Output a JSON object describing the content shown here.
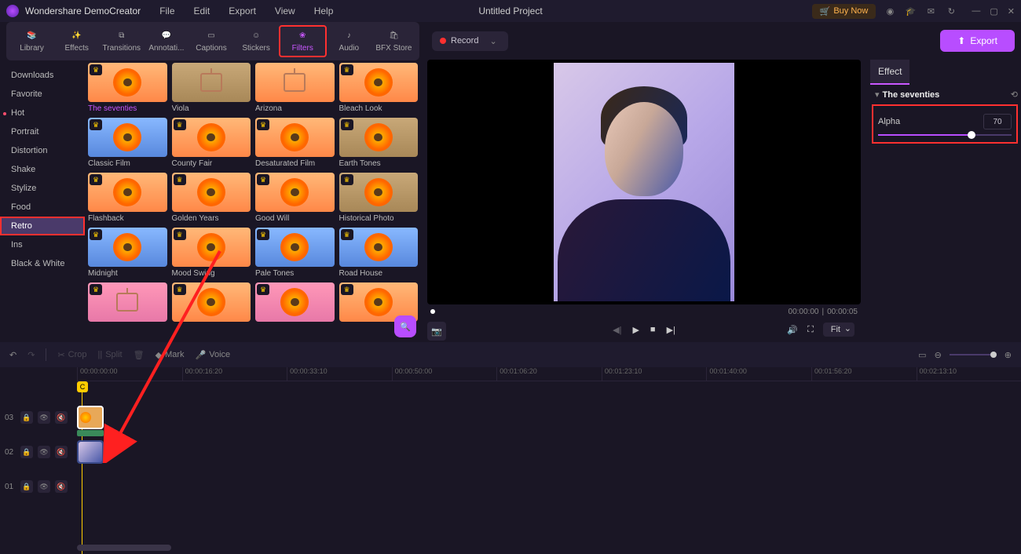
{
  "app": {
    "name": "Wondershare DemoCreator",
    "project": "Untitled Project"
  },
  "menubar": [
    "File",
    "Edit",
    "Export",
    "View",
    "Help"
  ],
  "buy": "Buy Now",
  "mode_tabs": [
    {
      "label": "Library",
      "icon": "📚"
    },
    {
      "label": "Effects",
      "icon": "✨"
    },
    {
      "label": "Transitions",
      "icon": "⧉"
    },
    {
      "label": "Annotati...",
      "icon": "💬"
    },
    {
      "label": "Captions",
      "icon": "▭"
    },
    {
      "label": "Stickers",
      "icon": "☺"
    },
    {
      "label": "Filters",
      "icon": "❀",
      "active": true
    },
    {
      "label": "Audio",
      "icon": "♪"
    },
    {
      "label": "BFX Store",
      "icon": "🛍"
    }
  ],
  "record": "Record",
  "export": "Export",
  "sidebar": [
    "Downloads",
    "Favorite",
    "Hot",
    "Portrait",
    "Distortion",
    "Shake",
    "Stylize",
    "Food",
    "Retro",
    "Ins",
    "Black & White"
  ],
  "sidebar_active_index": 8,
  "filters": [
    {
      "label": "The seventies",
      "tint": "t-warm",
      "crown": true,
      "selected": true,
      "tv": false
    },
    {
      "label": "Viola",
      "tint": "t-sepia",
      "crown": false,
      "tv": true
    },
    {
      "label": "Arizona",
      "tint": "t-warm",
      "crown": false,
      "tv": true
    },
    {
      "label": "Bleach Look",
      "tint": "t-warm",
      "crown": true,
      "tv": false
    },
    {
      "label": "Classic Film",
      "tint": "t-blue",
      "crown": true,
      "tv": false
    },
    {
      "label": "County Fair",
      "tint": "t-warm",
      "crown": true,
      "tv": false
    },
    {
      "label": "Desaturated Film",
      "tint": "t-warm",
      "crown": true,
      "tv": false
    },
    {
      "label": "Earth Tones",
      "tint": "t-sepia",
      "crown": true,
      "tv": false
    },
    {
      "label": "Flashback",
      "tint": "t-warm",
      "crown": true,
      "tv": false
    },
    {
      "label": "Golden Years",
      "tint": "t-warm",
      "crown": true,
      "tv": false
    },
    {
      "label": "Good Will",
      "tint": "t-warm",
      "crown": true,
      "tv": false
    },
    {
      "label": "Historical Photo",
      "tint": "t-sepia",
      "crown": true,
      "tv": false
    },
    {
      "label": "Midnight",
      "tint": "t-blue",
      "crown": true,
      "tv": false
    },
    {
      "label": "Mood Swing",
      "tint": "t-warm",
      "crown": true,
      "tv": false
    },
    {
      "label": "Pale Tones",
      "tint": "t-blue",
      "crown": true,
      "tv": false
    },
    {
      "label": "Road House",
      "tint": "t-blue",
      "crown": true,
      "tv": false
    },
    {
      "label": "",
      "tint": "t-pink",
      "crown": true,
      "tv": true
    },
    {
      "label": "",
      "tint": "t-warm",
      "crown": true,
      "tv": false
    },
    {
      "label": "",
      "tint": "t-pink",
      "crown": true,
      "tv": false
    },
    {
      "label": "",
      "tint": "t-warm",
      "crown": true,
      "tv": false
    }
  ],
  "preview": {
    "time_current": "00:00:00",
    "time_total": "00:00:05",
    "fit": "Fit"
  },
  "effect": {
    "title": "Effect",
    "group": "The seventies",
    "alpha_label": "Alpha",
    "alpha_value": "70"
  },
  "tl_tools": {
    "crop": "Crop",
    "split": "Split",
    "mark": "Mark",
    "voice": "Voice"
  },
  "ruler": [
    "00:00:00:00",
    "00:00:16:20",
    "00:00:33:10",
    "00:00:50:00",
    "00:01:06:20",
    "00:01:23:10",
    "00:01:40:00",
    "00:01:56:20",
    "00:02:13:10"
  ],
  "tracks": [
    "03",
    "02",
    "01"
  ]
}
